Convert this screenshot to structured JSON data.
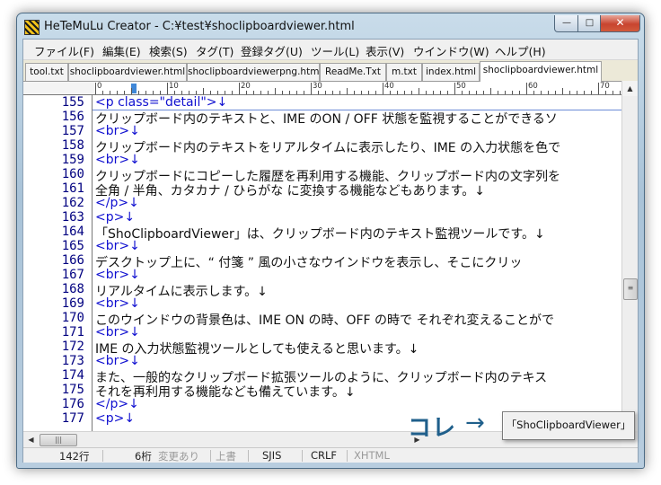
{
  "window": {
    "title": "HeTeMuLu Creator - C:¥test¥shoclipboardviewer.html",
    "caption_minimize": "—",
    "caption_maximize": "□",
    "caption_close": "✕"
  },
  "menu": [
    "ファイル(F)",
    "編集(E)",
    "検索(S)",
    "タグ(T)",
    "登録タグ(U)",
    "ツール(L)",
    "表示(V)",
    "ウインドウ(W)",
    "ヘルプ(H)"
  ],
  "tabs": [
    {
      "label": "tool.txt",
      "active": false
    },
    {
      "label": "shoclipboardviewer.html",
      "active": false
    },
    {
      "label": "shoclipboardviewerpng.html",
      "active": false
    },
    {
      "label": "ReadMe.Txt",
      "active": false
    },
    {
      "label": "m.txt",
      "active": false
    },
    {
      "label": "index.html",
      "active": false
    },
    {
      "label": "shoclipboardviewer.html",
      "active": true
    }
  ],
  "ruler": {
    "labels": [
      "0",
      "10",
      "20",
      "30",
      "40",
      "50",
      "60",
      "70"
    ]
  },
  "editor": {
    "lines": [
      {
        "num": "155",
        "text": "<p class=\"detail\">↓",
        "tag": true
      },
      {
        "num": "156",
        "text": "クリップボード内のテキストと、IME のON / OFF 状態を監視することができるソ",
        "tag": false
      },
      {
        "num": "157",
        "text": "<br>↓",
        "tag": true
      },
      {
        "num": "158",
        "text": "クリップボード内のテキストをリアルタイムに表示したり、IME の入力状態を色で",
        "tag": false
      },
      {
        "num": "159",
        "text": "<br>↓",
        "tag": true
      },
      {
        "num": "160",
        "text": "クリップボードにコピーした履歴を再利用する機能、クリップボード内の文字列を",
        "tag": false
      },
      {
        "num": "161",
        "text": "全角 / 半角、カタカナ / ひらがな に変換する機能などもあります。↓",
        "tag": false
      },
      {
        "num": "162",
        "text": "</p>↓",
        "tag": true
      },
      {
        "num": "163",
        "text": "<p>↓",
        "tag": true
      },
      {
        "num": "164",
        "text": "「ShoClipboardViewer」は、クリップボード内のテキスト監視ツールです。↓",
        "tag": false
      },
      {
        "num": "165",
        "text": "<br>↓",
        "tag": true
      },
      {
        "num": "166",
        "text": "デスクトップ上に、“ 付箋 ” 風の小さなウインドウを表示し、そこにクリッ",
        "tag": false
      },
      {
        "num": "167",
        "text": "<br>↓",
        "tag": true
      },
      {
        "num": "168",
        "text": "リアルタイムに表示します。↓",
        "tag": false
      },
      {
        "num": "169",
        "text": "<br>↓",
        "tag": true
      },
      {
        "num": "170",
        "text": "このウインドウの背景色は、IME ON の時、OFF の時で それぞれ変えることがで",
        "tag": false
      },
      {
        "num": "171",
        "text": "<br>↓",
        "tag": true
      },
      {
        "num": "172",
        "text": "IME の入力状態監視ツールとしても使えると思います。↓",
        "tag": false
      },
      {
        "num": "173",
        "text": "<br>↓",
        "tag": true
      },
      {
        "num": "174",
        "text": "また、一般的なクリップボード拡張ツールのように、クリップボード内のテキス",
        "tag": false
      },
      {
        "num": "175",
        "text": "それを再利用する機能なども備えています。↓",
        "tag": false
      },
      {
        "num": "176",
        "text": "</p>↓",
        "tag": true
      },
      {
        "num": "177",
        "text": "<p>↓",
        "tag": true
      }
    ]
  },
  "scrollbar": {
    "thumb_glyph": "≡",
    "up": "▲",
    "down": "▼",
    "left": "◀",
    "right": "▶",
    "hthumb_glyph": "|||"
  },
  "status": {
    "lines": "142行",
    "column": "6桁",
    "modified": "変更あり",
    "overwrite": "上書",
    "encoding": "SJIS",
    "newline": "CRLF",
    "mode": "XHTML"
  },
  "overlay": {
    "label": "コレ",
    "arrow": "→",
    "floating_window_text": "「ShoClipboardViewer」"
  }
}
